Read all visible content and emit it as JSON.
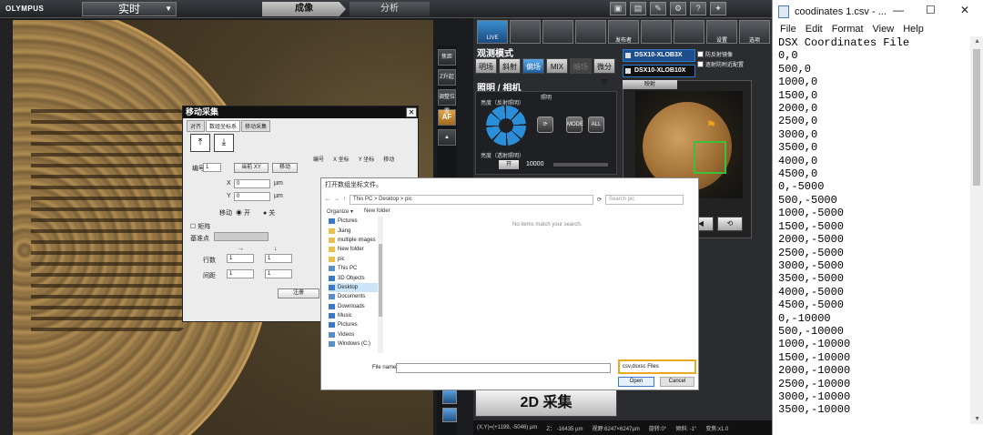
{
  "app": {
    "logo": "OLYMPUS",
    "mode_select": "实时",
    "tab_imaging": "成像",
    "tab_analysis": "分析"
  },
  "side_tools": [
    "焦距",
    "Z升起",
    "调整位置",
    "AF"
  ],
  "right_panel": {
    "icon_row": [
      "LIVE",
      "",
      "",
      "",
      "发布者",
      "",
      "",
      "设置",
      "选项"
    ],
    "observation_title": "观测模式",
    "observation_buttons": [
      "明场",
      "斜射",
      "偏场",
      "MIX",
      "暗场",
      "微分干"
    ],
    "observation_selected": "偏场",
    "illumination_title": "照明 / 相机",
    "illum_sub": "照明",
    "reflect_label": "亮度（反射照明）",
    "transmit_label": "亮度（透射照明）",
    "transmit_btn": "开",
    "transmit_value": "10000",
    "mode_btn": "MODE",
    "all_btn": "ALL",
    "lenses": [
      "DSX10-XLOB3X",
      "DSX10-XLOB10X"
    ],
    "checks": [
      "防反射镜像",
      "逐射防附近配置"
    ],
    "minimap_title": "映射",
    "acquire_2d": "2D 采集",
    "status": [
      "(X,Y)=(+1199, -5046) µm",
      "Z： -16435 µm",
      "视野:6247×6247µm",
      "旋转:0°",
      "倾斜: -1°",
      "变焦:x1.0"
    ]
  },
  "move_dialog": {
    "title": "移动采集",
    "tabs": [
      "对齐",
      "数组坐标系",
      "移动采集"
    ],
    "number_label": "编号",
    "number_value": "1",
    "current_xy": "当前 XY",
    "move_btn": "移动",
    "x_label": "X",
    "x_value": "0",
    "y_label": "Y",
    "y_value": "0",
    "unit": "µm",
    "move_label": "移动",
    "on": "开",
    "off": "关",
    "matrix_label": "矩阵",
    "base_point": "基准点",
    "rows_label": "行",
    "cols_label": "列",
    "rowcount_label": "行数",
    "spacing_label": "间距",
    "one": "1",
    "confirm_btn": "注册",
    "list_headers": [
      "编号",
      "X 坐标",
      "Y 坐标",
      "移动"
    ]
  },
  "file_dialog": {
    "title": "打开数组坐标文件。",
    "path": "This PC  >  Desktop  >  pic",
    "search_placeholder": "Search pic",
    "organize": "Organize ▾",
    "new_folder": "New folder",
    "nav_items": [
      "Pictures",
      "Jiang",
      "multiple images",
      "New folder",
      "pic",
      "This PC",
      "3D Objects",
      "Desktop",
      "Documents",
      "Downloads",
      "Music",
      "Pictures",
      "Videos",
      "Windows (C:)"
    ],
    "nav_selected": "Desktop",
    "empty_msg": "No items match your search.",
    "file_name_label": "File name:",
    "file_type": "csv,dsxsc Files",
    "open_btn": "Open",
    "cancel_btn": "Cancel"
  },
  "notepad": {
    "title": "coodinates 1.csv - ...",
    "minimize": "—",
    "maximize": "☐",
    "close": "✕",
    "menu": [
      "File",
      "Edit",
      "Format",
      "View",
      "Help"
    ],
    "lines": [
      "DSX Coordinates File",
      "0,0",
      "500,0",
      "1000,0",
      "1500,0",
      "2000,0",
      "2500,0",
      "3000,0",
      "3500,0",
      "4000,0",
      "4500,0",
      "0,-5000",
      "500,-5000",
      "1000,-5000",
      "1500,-5000",
      "2000,-5000",
      "2500,-5000",
      "3000,-5000",
      "3500,-5000",
      "4000,-5000",
      "4500,-5000",
      "0,-10000",
      "500,-10000",
      "1000,-10000",
      "1500,-10000",
      "2000,-10000",
      "2500,-10000",
      "3000,-10000",
      "3500,-10000"
    ]
  }
}
